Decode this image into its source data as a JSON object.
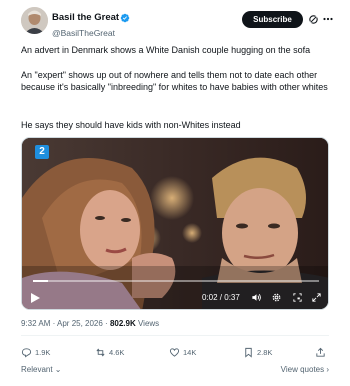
{
  "author": {
    "display_name": "Basil the Great",
    "handle": "@BasilTheGreat",
    "verified": true
  },
  "header": {
    "subscribe_label": "Subscribe"
  },
  "tweet_text": {
    "line1": "An advert in Denmark shows a White Danish couple hugging on the sofa",
    "line2": "An \"expert\" shows up out of nowhere and tells them not to date each other because it's basically \"inbreeding\" for whites to have babies with other whites",
    "line3": "He says they should have kids with non-Whites instead"
  },
  "video": {
    "channel_badge": "2",
    "time_readout": "0:02 / 0:37",
    "progress_fraction": 0.054
  },
  "meta": {
    "timestamp": "9:32 AM · Apr 25, 2026 · ",
    "views_count": "802.9K",
    "views_label": " Views"
  },
  "actions": {
    "replies": "1.9K",
    "reposts": "4.6K",
    "likes": "14K",
    "bookmarks": "2.8K"
  },
  "footer": {
    "relevant_label": "Relevant",
    "view_quotes_label": "View quotes ›"
  },
  "colors": {
    "verified_blue": "#1d9bf0",
    "text_primary": "#0f1419",
    "text_secondary": "#536471",
    "channel_blue": "#1f8fde"
  }
}
